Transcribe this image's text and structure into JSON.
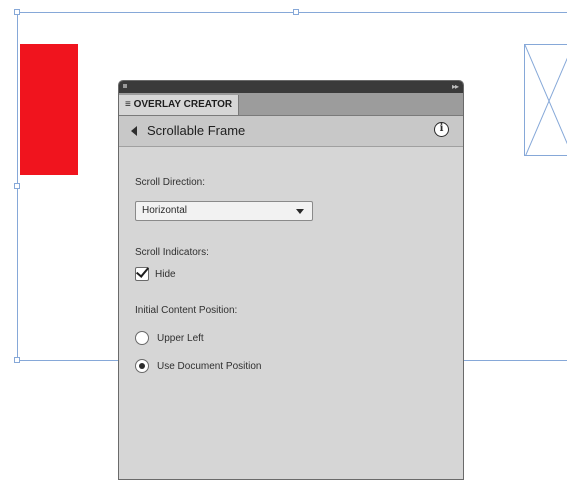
{
  "panel": {
    "tab_label": "≡ OVERLAY CREATOR",
    "header_title": "Scrollable Frame",
    "info_glyph": "i",
    "scroll_direction": {
      "label": "Scroll Direction:",
      "selected": "Horizontal"
    },
    "scroll_indicators": {
      "label": "Scroll Indicators:",
      "hide_label": "Hide",
      "hide_checked": true
    },
    "initial_position": {
      "label": "Initial Content Position:",
      "options": [
        {
          "label": "Upper Left",
          "selected": false
        },
        {
          "label": "Use Document Position",
          "selected": true
        }
      ]
    }
  },
  "colors": {
    "accent_red": "#f0141e",
    "frame_blue": "#86a8d8",
    "panel_bg": "#d6d6d6"
  }
}
